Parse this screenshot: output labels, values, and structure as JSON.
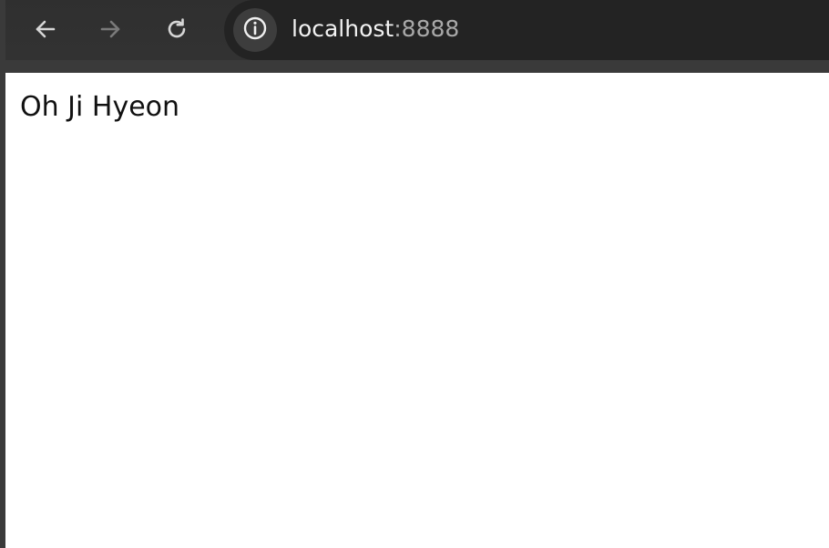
{
  "browser": {
    "url": {
      "host": "localhost",
      "port": ":8888"
    },
    "icons": {
      "back": "arrow-left-icon",
      "forward": "arrow-right-icon",
      "reload": "reload-icon",
      "site_info": "info-icon"
    },
    "colors": {
      "toolbar": "#333333",
      "omnibox": "#232323",
      "icon_active": "#d6d6d6",
      "icon_disabled": "#7a7a7a"
    }
  },
  "page": {
    "text": "Oh Ji Hyeon"
  }
}
